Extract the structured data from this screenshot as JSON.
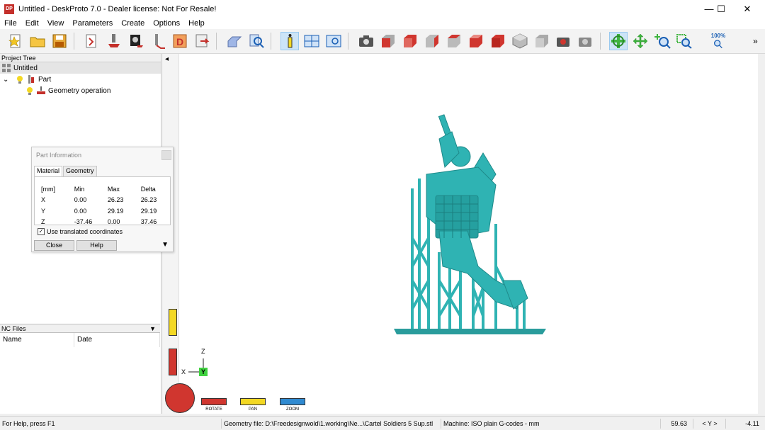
{
  "window": {
    "app_icon_text": "DP",
    "title": "Untitled - DeskProto 7.0 - Dealer license: Not For Resale!",
    "minimize": "—",
    "maximize": "☐",
    "close": "✕"
  },
  "menu": [
    "File",
    "Edit",
    "View",
    "Parameters",
    "Create",
    "Options",
    "Help"
  ],
  "toolbar": {
    "zoom100_label": "100%",
    "overflow": "»",
    "buttons": [
      "new-file-icon",
      "open-folder-icon",
      "save-icon",
      "import-geometry-icon",
      "geometry-operation-icon",
      "bitmap-operation-icon",
      "vector-operation-icon",
      "dxf-icon",
      "export-icon",
      "part-icon",
      "inspect-icon",
      "info-icon",
      "view-split-icon",
      "view-single-icon",
      "camera-icon",
      "view-front-icon",
      "view-back-icon",
      "view-left-icon",
      "view-right-icon",
      "view-top-icon",
      "view-bottom-icon",
      "view-iso-icon",
      "view-iso2-icon",
      "rotate-view-icon",
      "capture-icon",
      "rotate-icon",
      "pan-icon",
      "zoom-in-icon",
      "zoom-window-icon",
      "zoom-100-icon"
    ],
    "accent": "#2f8ad1"
  },
  "project_tree": {
    "header": "Project Tree",
    "root": "Untitled",
    "part": "Part",
    "operation": "Geometry operation"
  },
  "nc_files": {
    "header": "NC Files",
    "columns": [
      "Name",
      "Date"
    ]
  },
  "dialog": {
    "title": "Part Information",
    "tabs": [
      "Material",
      "Geometry"
    ],
    "table_header": [
      "[mm]",
      "Min",
      "Max",
      "Delta"
    ],
    "rows": [
      {
        "axis": "X",
        "min": "0.00",
        "max": "26.23",
        "delta": "26.23"
      },
      {
        "axis": "Y",
        "min": "0.00",
        "max": "29.19",
        "delta": "29.19"
      },
      {
        "axis": "Z",
        "min": "-37.46",
        "max": "0.00",
        "delta": "37.46"
      }
    ],
    "checkbox_label": "Use translated coordinates",
    "checkbox_checked": true,
    "close_label": "Close",
    "help_label": "Help"
  },
  "viewport": {
    "model_color": "#2fb3b3",
    "axis_z": "Z",
    "axis_x": "X",
    "axis_y": "Y",
    "collapse_arrow": "◂",
    "controls": [
      "ROTATE",
      "PAN",
      "ZOOM"
    ]
  },
  "status": {
    "help": "For Help, press F1",
    "geometry_file": "Geometry file: D:\\Freedesignwold\\1.working\\Ne...\\Cartel Soldiers 5 Sup.stl",
    "machine": "Machine: ISO plain G-codes - mm",
    "coord1": "59.63",
    "axis": "< Y >",
    "coord2": "-4.11"
  }
}
